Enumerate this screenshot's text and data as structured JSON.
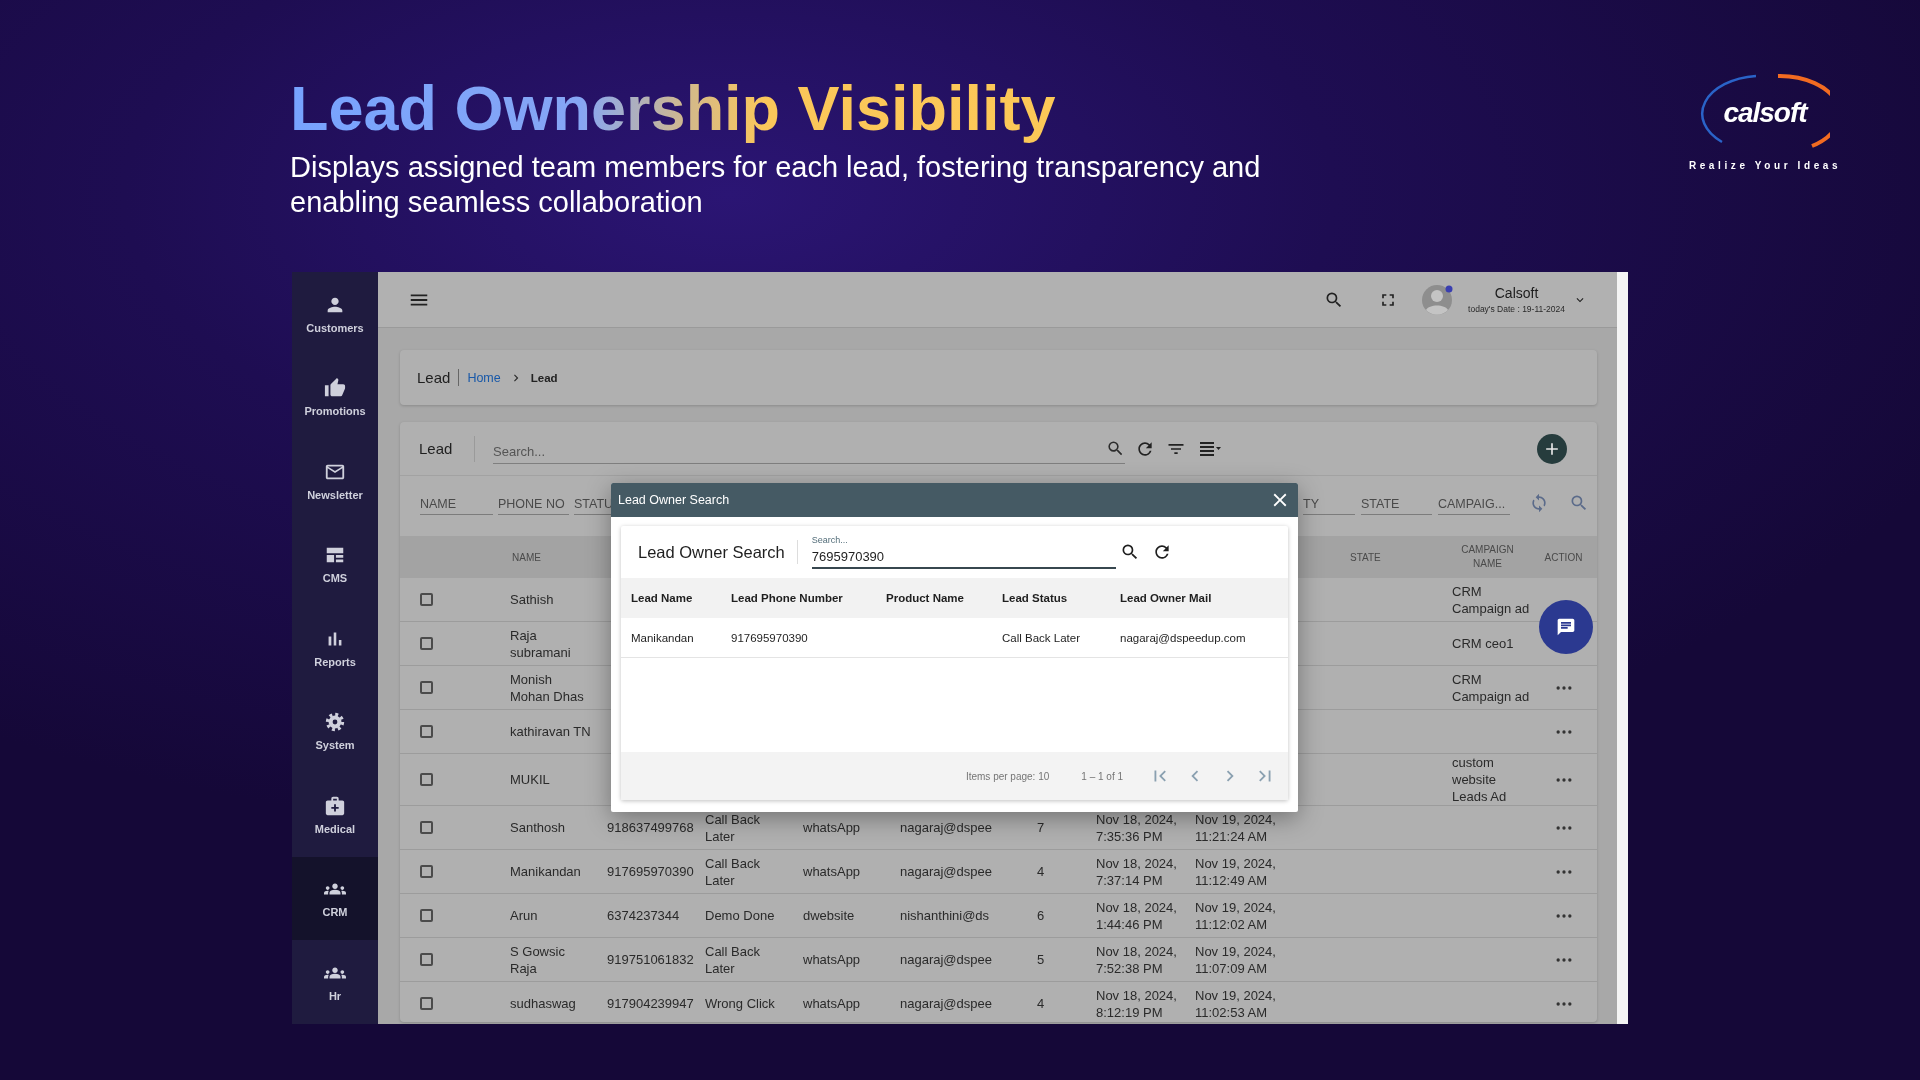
{
  "slide": {
    "title": "Lead Ownership Visibility",
    "subtitle": "Displays assigned team members for each lead, fostering transparency and enabling seamless collaboration"
  },
  "logo": {
    "name": "calsoft",
    "tagline": "Realize Your Ideas"
  },
  "sidebar": {
    "items": [
      {
        "label": "Customers",
        "selected": false
      },
      {
        "label": "Promotions",
        "selected": false
      },
      {
        "label": "Newsletter",
        "selected": false
      },
      {
        "label": "CMS",
        "selected": false
      },
      {
        "label": "Reports",
        "selected": false
      },
      {
        "label": "System",
        "selected": false
      },
      {
        "label": "Medical",
        "selected": false
      },
      {
        "label": "CRM",
        "selected": true
      },
      {
        "label": "Hr",
        "selected": false
      }
    ]
  },
  "topbar": {
    "user_name": "Calsoft",
    "date": "today's Date : 19-11-2024"
  },
  "breadcrumb": {
    "title": "Lead",
    "link": "Home",
    "current": "Lead"
  },
  "lead_table": {
    "title": "Lead",
    "search": {
      "placeholder": "Search..."
    },
    "filters": [
      {
        "label": "NAME"
      },
      {
        "label": "PHONE NO"
      },
      {
        "label": "STATU"
      },
      {
        "label": "TY"
      },
      {
        "label": "STATE"
      },
      {
        "label": "CAMPAIG..."
      }
    ],
    "columns": [
      {
        "label": "NAME"
      },
      {
        "label": "STATE"
      },
      {
        "label": "CAMPAIGN NAME"
      },
      {
        "label": "ACTION"
      }
    ],
    "rows": [
      {
        "checked": false,
        "name": "Sathish",
        "campaign": "CRM Campaign ad",
        "actions_menu": false
      },
      {
        "checked": false,
        "name": "Raja subramani",
        "campaign": "CRM ceo1",
        "actions_menu": false
      },
      {
        "checked": false,
        "name": "Monish Mohan Dhas",
        "campaign": "CRM Campaign ad",
        "actions_menu": true
      },
      {
        "checked": false,
        "name": "kathiravan TN",
        "actions_menu": true
      },
      {
        "checked": false,
        "name": "MUKIL",
        "campaign": "custom website Leads Ad",
        "actions_menu": true
      },
      {
        "checked": false,
        "name": "Santhosh",
        "phone": "918637499768",
        "status": "Call Back Later",
        "product": "whatsApp",
        "owner": "nagaraj@dspee",
        "count": "7",
        "created": "Nov 18, 2024, 7:35:36 PM",
        "updated": "Nov 19, 2024, 11:21:24 AM",
        "actions_menu": true
      },
      {
        "checked": false,
        "name": "Manikandan",
        "phone": "917695970390",
        "status": "Call Back Later",
        "product": "whatsApp",
        "owner": "nagaraj@dspee",
        "count": "4",
        "created": "Nov 18, 2024, 7:37:14 PM",
        "updated": "Nov 19, 2024, 11:12:49 AM",
        "actions_menu": true
      },
      {
        "checked": false,
        "name": "Arun",
        "phone": "6374237344",
        "status": "Demo Done",
        "product": "dwebsite",
        "owner": "nishanthini@ds",
        "count": "6",
        "created": "Nov 18, 2024, 1:44:46 PM",
        "updated": "Nov 19, 2024, 11:12:02 AM",
        "actions_menu": true
      },
      {
        "checked": false,
        "name": "S Gowsic Raja",
        "phone": "919751061832",
        "status": "Call Back Later",
        "product": "whatsApp",
        "owner": "nagaraj@dspee",
        "count": "5",
        "created": "Nov 18, 2024, 7:52:38 PM",
        "updated": "Nov 19, 2024, 11:07:09 AM",
        "actions_menu": true
      },
      {
        "checked": false,
        "name": "sudhaswag",
        "phone": "917904239947",
        "status": "Wrong Click",
        "product": "whatsApp",
        "owner": "nagaraj@dspee",
        "count": "4",
        "created": "Nov 18, 2024, 8:12:19 PM",
        "updated": "Nov 19, 2024, 11:02:53 AM",
        "actions_menu": true
      }
    ]
  },
  "modal": {
    "title": "Lead Owner Search",
    "card_title": "Lead Owner Search",
    "search": {
      "label": "Search...",
      "value": "7695970390"
    },
    "columns": [
      {
        "label": "Lead Name"
      },
      {
        "label": "Lead Phone Number"
      },
      {
        "label": "Product Name"
      },
      {
        "label": "Lead Status"
      },
      {
        "label": "Lead Owner Mail"
      }
    ],
    "rows": [
      {
        "name": "Manikandan",
        "phone": "917695970390",
        "status": "Call Back Later",
        "owner_mail": "nagaraj@dspeedup.com"
      }
    ],
    "paginator": {
      "page_size": "Items per page: 10",
      "range": "1 – 1 of 1"
    }
  }
}
